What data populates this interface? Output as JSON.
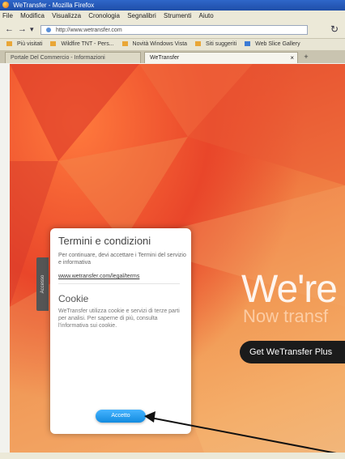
{
  "window": {
    "title": "WeTransfer - Mozilla Firefox"
  },
  "menu": [
    "File",
    "Modifica",
    "Visualizza",
    "Cronologia",
    "Segnalibri",
    "Strumenti",
    "Aiuto"
  ],
  "address": {
    "url": "http://www.wetransfer.com"
  },
  "bookmarks": [
    "Più visitati",
    "Wildfire TNT - Pers...",
    "Novità Windows Vista",
    "Siti suggeriti",
    "Web Slice Gallery"
  ],
  "tabs": [
    {
      "label": "Portale Del Commercio - Informazioni"
    },
    {
      "label": "WeTransfer"
    }
  ],
  "terms": {
    "title": "Termini e condizioni",
    "body": "Per continuare, devi accettare i Termini del servizio e informativa",
    "link": "www.wetransfer.com/legal/terms",
    "cookie_title": "Cookie",
    "cookie_body": "WeTransfer utilizza cookie e servizi di terze parti per analisi. Per saperne di più, consulta l'informativa sui cookie.",
    "accept_label": "Accetto"
  },
  "side_tab": {
    "label": "Accesso"
  },
  "hero": {
    "headline": "We're",
    "subline": "Now transf",
    "plus_label": "Get WeTransfer Plus"
  },
  "colors": {
    "accent": "#138bdf",
    "hero_dark": "#1b1b1b"
  }
}
